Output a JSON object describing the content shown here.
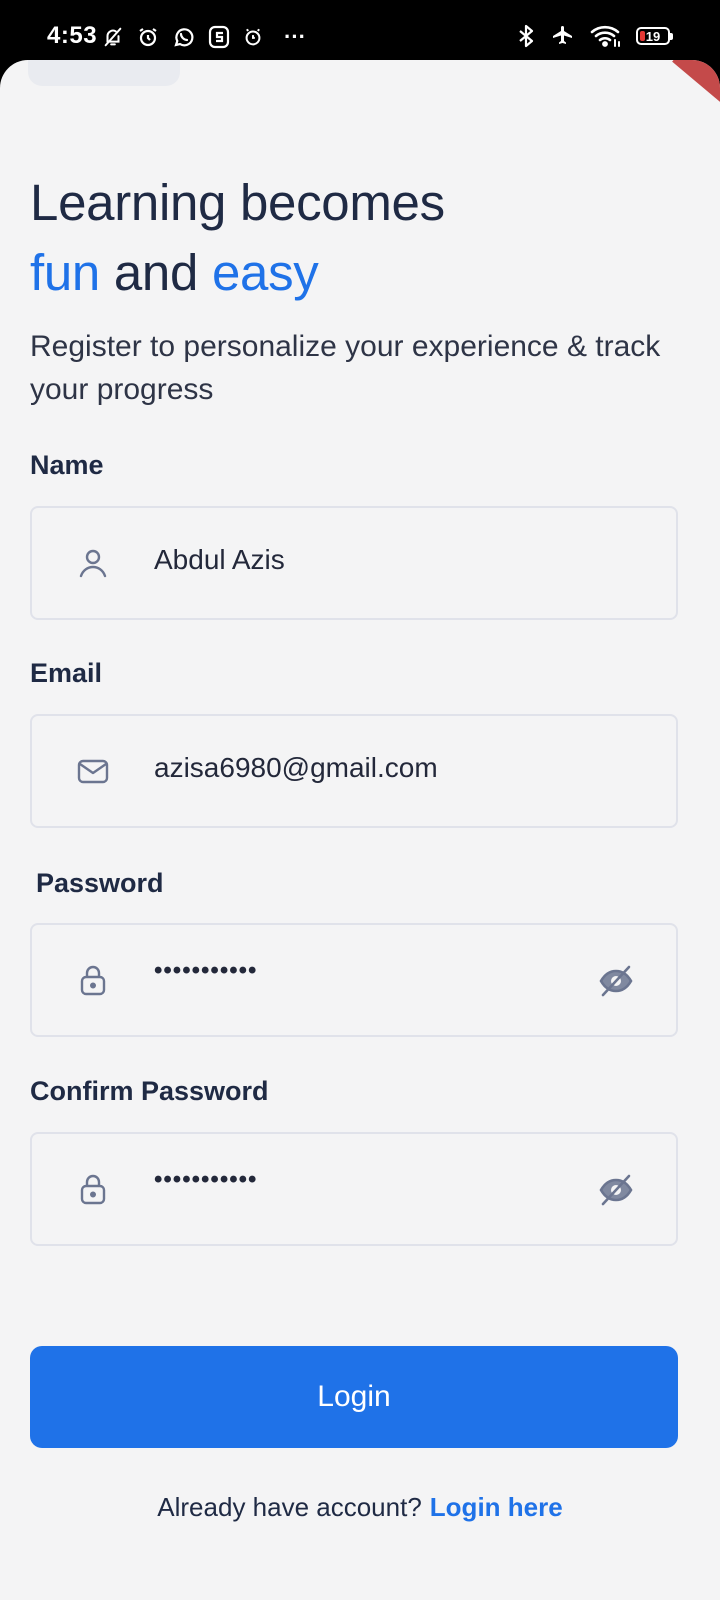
{
  "status_bar": {
    "time": "4:53",
    "more": "···",
    "battery_level": "19"
  },
  "header": {
    "title_line1": "Learning becomes",
    "title_accent1": "fun",
    "title_mid": " and ",
    "title_accent2": "easy",
    "subtitle": "Register to personalize your experience & track your progress"
  },
  "form": {
    "name": {
      "label": "Name",
      "value": "Abdul Azis",
      "icon": "user-icon"
    },
    "email": {
      "label": "Email",
      "value": "azisa6980@gmail.com",
      "icon": "mail-icon"
    },
    "password": {
      "label": "Password",
      "value": "•••••••••••",
      "icon": "lock-icon",
      "toggle_icon": "eye-off-icon"
    },
    "confirm_password": {
      "label": "Confirm Password",
      "value": "•••••••••••",
      "icon": "lock-icon",
      "toggle_icon": "eye-off-icon"
    }
  },
  "actions": {
    "submit_label": "Login",
    "footer_text": "Already have account?",
    "footer_link": "Login here"
  },
  "colors": {
    "accent": "#1f72e8",
    "text_dark": "#1f2a44",
    "background": "#f4f4f5",
    "border": "#e0e2ea"
  }
}
